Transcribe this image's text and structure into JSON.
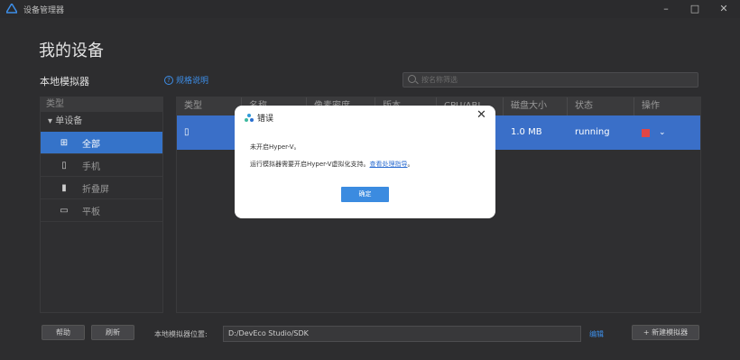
{
  "window": {
    "title": "设备管理器",
    "minimize": "–",
    "maximize": "□",
    "close": "✕"
  },
  "page_title": "我的设备",
  "section_title": "本地模拟器",
  "help_link": "规格说明",
  "search": {
    "placeholder": "按名称筛选"
  },
  "sidebar": {
    "header": "类型",
    "group": "▾ 单设备",
    "items": [
      {
        "label": "全部",
        "icon": "grid-icon"
      },
      {
        "label": "手机",
        "icon": "phone-icon"
      },
      {
        "label": "折叠屏",
        "icon": "foldable-icon"
      },
      {
        "label": "平板",
        "icon": "tablet-icon"
      }
    ]
  },
  "table": {
    "columns": [
      "类型",
      "名称",
      "像素密度",
      "版本",
      "CPU/ABI",
      "磁盘大小",
      "状态",
      "操作"
    ],
    "row": {
      "type_icon": "phone-icon",
      "disk": "1.0 MB",
      "status": "running"
    }
  },
  "dialog": {
    "title": "错误",
    "message1": "未开启Hyper-V。",
    "message2": "运行模拟器需要开启Hyper-V虚拟化支持。",
    "link": "查看处理指导",
    "period": "。",
    "ok": "确定"
  },
  "footer": {
    "help": "帮助",
    "refresh": "刷新",
    "location_label": "本地模拟器位置:",
    "location_value": "D:/DevEco Studio/SDK",
    "edit": "编辑",
    "new_emulator": "+ 新建模拟器"
  }
}
